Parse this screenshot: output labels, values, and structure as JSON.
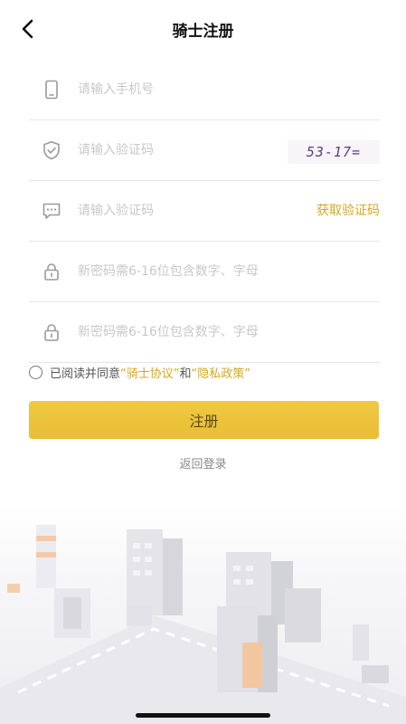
{
  "header": {
    "title": "骑士注册"
  },
  "form": {
    "phone_placeholder": "请输入手机号",
    "captcha_placeholder": "请输入验证码",
    "captcha_image_text": "53-17=",
    "sms_placeholder": "请输入验证码",
    "get_code_label": "获取验证码",
    "password_placeholder": "新密码需6-16位包含数字、字母",
    "confirm_placeholder": "新密码需6-16位包含数字、字母"
  },
  "agreement": {
    "prefix": "已阅读并同意",
    "link1": "“骑士协议”",
    "mid": "和",
    "link2": "“隐私政策”"
  },
  "actions": {
    "register_label": "注册",
    "back_login_label": "返回登录"
  },
  "colors": {
    "accent": "#d6a81e",
    "button": "#efc543",
    "divider": "#e6e6e6"
  },
  "icons": [
    "back-arrow-icon",
    "phone-icon",
    "shield-check-icon",
    "message-icon",
    "lock-icon",
    "lock-icon"
  ]
}
